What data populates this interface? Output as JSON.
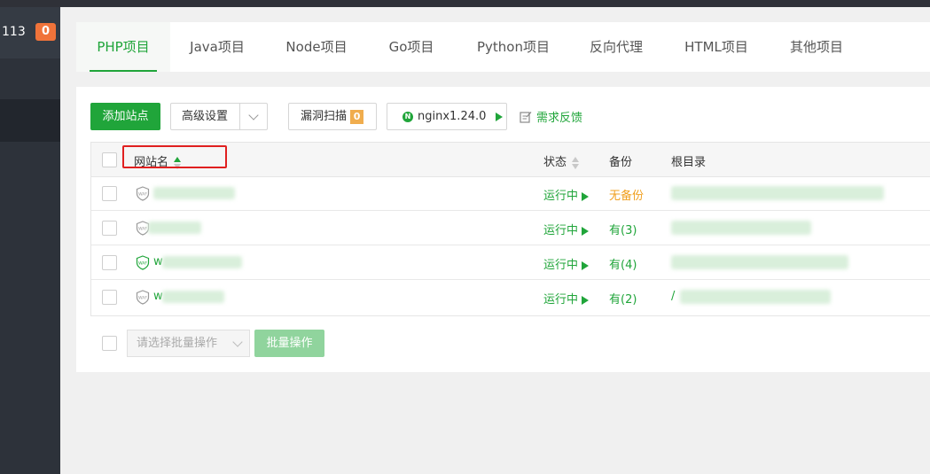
{
  "sidebar": {
    "count": "113",
    "badge": "0"
  },
  "tabs": [
    {
      "label": "PHP项目",
      "active": true
    },
    {
      "label": "Java项目"
    },
    {
      "label": "Node项目"
    },
    {
      "label": "Go项目"
    },
    {
      "label": "Python项目"
    },
    {
      "label": "反向代理"
    },
    {
      "label": "HTML项目"
    },
    {
      "label": "其他项目"
    }
  ],
  "toolbar": {
    "add_site": "添加站点",
    "advanced": "高级设置",
    "vuln_scan": "漏洞扫描",
    "vuln_count": "0",
    "nginx": "nginx1.24.0",
    "nginx_icon": "N",
    "feedback": "需求反馈"
  },
  "table": {
    "columns": {
      "name": "网站名",
      "status": "状态",
      "backup": "备份",
      "root": "根目录"
    },
    "rows": [
      {
        "name": "",
        "status": "运行中",
        "backup": "无备份",
        "root": "",
        "waf_active": false
      },
      {
        "name": "",
        "status": "运行中",
        "backup": "有(3)",
        "root": "",
        "waf_active": false
      },
      {
        "name": "w",
        "status": "运行中",
        "backup": "有(4)",
        "root": "",
        "waf_active": true
      },
      {
        "name": "w",
        "status": "运行中",
        "backup": "有(2)",
        "root": "/",
        "waf_active": false
      }
    ]
  },
  "bottom": {
    "batch_placeholder": "请选择批量操作",
    "batch_button": "批量操作"
  },
  "colors": {
    "accent": "#20a53a",
    "warning": "#f0a020",
    "highlight": "#e02020",
    "sidebar_bg": "#2d323a"
  }
}
